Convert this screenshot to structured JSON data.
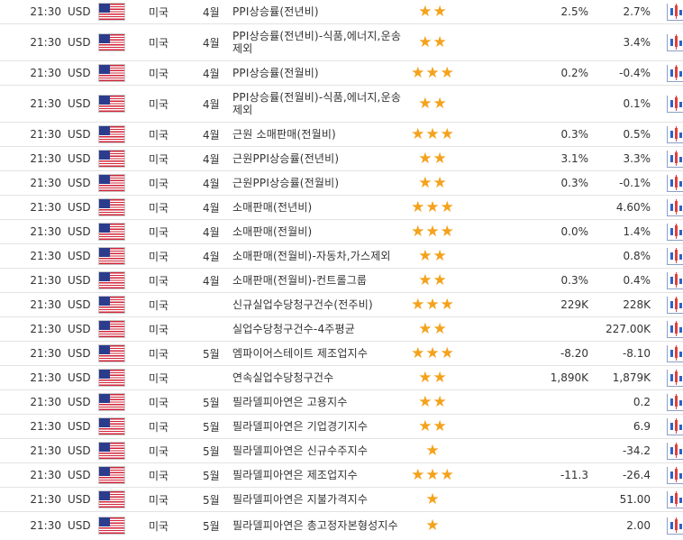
{
  "colors": {
    "star": "#f4a21c",
    "row_border": "#e3e3e3",
    "flag_red": "#d0263a",
    "flag_blue": "#2c3c8c"
  },
  "icons": {
    "flag": "us-flag-icon",
    "importance": "star-icon",
    "chart": "candlestick-chart-icon"
  },
  "rows": [
    {
      "time": "21:30",
      "currency": "USD",
      "country": "미국",
      "month": "4월",
      "event": "PPI상승률(전년비)",
      "stars": 2,
      "previous": "2.5%",
      "forecast": "2.7%"
    },
    {
      "time": "21:30",
      "currency": "USD",
      "country": "미국",
      "month": "4월",
      "event": "PPI상승률(전년비)-식품,에너지,운송제외",
      "stars": 2,
      "previous": "",
      "forecast": "3.4%"
    },
    {
      "time": "21:30",
      "currency": "USD",
      "country": "미국",
      "month": "4월",
      "event": "PPI상승률(전월비)",
      "stars": 3,
      "previous": "0.2%",
      "forecast": "-0.4%"
    },
    {
      "time": "21:30",
      "currency": "USD",
      "country": "미국",
      "month": "4월",
      "event": "PPI상승률(전월비)-식품,에너지,운송제외",
      "stars": 2,
      "previous": "",
      "forecast": "0.1%"
    },
    {
      "time": "21:30",
      "currency": "USD",
      "country": "미국",
      "month": "4월",
      "event": "근원 소매판매(전월비)",
      "stars": 3,
      "previous": "0.3%",
      "forecast": "0.5%"
    },
    {
      "time": "21:30",
      "currency": "USD",
      "country": "미국",
      "month": "4월",
      "event": "근원PPI상승률(전년비)",
      "stars": 2,
      "previous": "3.1%",
      "forecast": "3.3%"
    },
    {
      "time": "21:30",
      "currency": "USD",
      "country": "미국",
      "month": "4월",
      "event": "근원PPI상승률(전월비)",
      "stars": 2,
      "previous": "0.3%",
      "forecast": "-0.1%"
    },
    {
      "time": "21:30",
      "currency": "USD",
      "country": "미국",
      "month": "4월",
      "event": "소매판매(전년비)",
      "stars": 3,
      "previous": "",
      "forecast": "4.60%"
    },
    {
      "time": "21:30",
      "currency": "USD",
      "country": "미국",
      "month": "4월",
      "event": "소매판매(전월비)",
      "stars": 3,
      "previous": "0.0%",
      "forecast": "1.4%"
    },
    {
      "time": "21:30",
      "currency": "USD",
      "country": "미국",
      "month": "4월",
      "event": "소매판매(전월비)-자동차,가스제외",
      "stars": 2,
      "previous": "",
      "forecast": "0.8%"
    },
    {
      "time": "21:30",
      "currency": "USD",
      "country": "미국",
      "month": "4월",
      "event": "소매판매(전월비)-컨트롤그룹",
      "stars": 2,
      "previous": "0.3%",
      "forecast": "0.4%"
    },
    {
      "time": "21:30",
      "currency": "USD",
      "country": "미국",
      "month": "",
      "event": "신규실업수당청구건수(전주비)",
      "stars": 3,
      "previous": "229K",
      "forecast": "228K"
    },
    {
      "time": "21:30",
      "currency": "USD",
      "country": "미국",
      "month": "",
      "event": "실업수당청구건수-4주평균",
      "stars": 2,
      "previous": "",
      "forecast": "227.00K"
    },
    {
      "time": "21:30",
      "currency": "USD",
      "country": "미국",
      "month": "5월",
      "event": "엠파이어스테이트 제조업지수",
      "stars": 3,
      "previous": "-8.20",
      "forecast": "-8.10"
    },
    {
      "time": "21:30",
      "currency": "USD",
      "country": "미국",
      "month": "",
      "event": "연속실업수당청구건수",
      "stars": 2,
      "previous": "1,890K",
      "forecast": "1,879K"
    },
    {
      "time": "21:30",
      "currency": "USD",
      "country": "미국",
      "month": "5월",
      "event": "필라델피아연은 고용지수",
      "stars": 2,
      "previous": "",
      "forecast": "0.2"
    },
    {
      "time": "21:30",
      "currency": "USD",
      "country": "미국",
      "month": "5월",
      "event": "필라델피아연은 기업경기지수",
      "stars": 2,
      "previous": "",
      "forecast": "6.9"
    },
    {
      "time": "21:30",
      "currency": "USD",
      "country": "미국",
      "month": "5월",
      "event": "필라델피아연은 신규수주지수",
      "stars": 1,
      "previous": "",
      "forecast": "-34.2"
    },
    {
      "time": "21:30",
      "currency": "USD",
      "country": "미국",
      "month": "5월",
      "event": "필라델피아연은 제조업지수",
      "stars": 3,
      "previous": "-11.3",
      "forecast": "-26.4"
    },
    {
      "time": "21:30",
      "currency": "USD",
      "country": "미국",
      "month": "5월",
      "event": "필라델피아연은 지불가격지수",
      "stars": 1,
      "previous": "",
      "forecast": "51.00"
    },
    {
      "time": "21:30",
      "currency": "USD",
      "country": "미국",
      "month": "5월",
      "event": "필라델피아연은 총고정자본형성지수",
      "stars": 1,
      "previous": "",
      "forecast": "2.00"
    }
  ]
}
